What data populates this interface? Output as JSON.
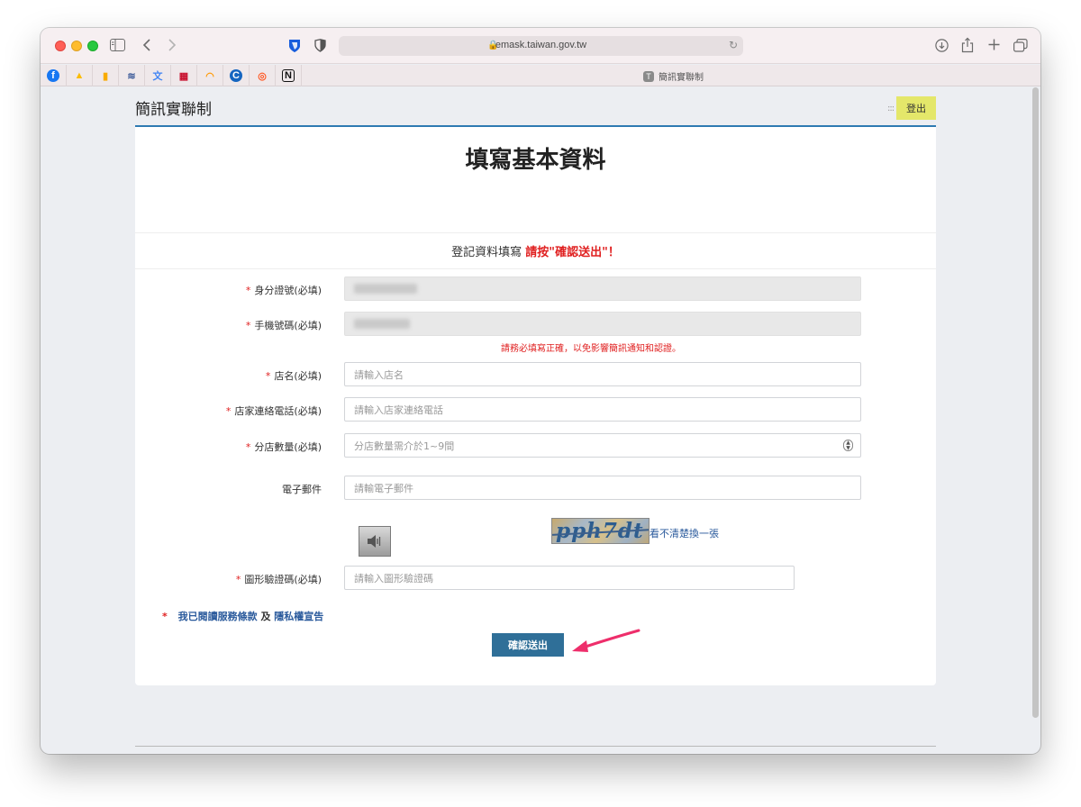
{
  "browser": {
    "url": "emask.taiwan.gov.tw",
    "tab_title": "簡訊實聯制",
    "tab_icon_letter": "T",
    "favorites": [
      {
        "icon": "facebook-icon",
        "glyph": "f",
        "color": "#1877f2"
      },
      {
        "icon": "google-ads-icon",
        "glyph": "▲",
        "color": "#fbbc04"
      },
      {
        "icon": "analytics-icon",
        "glyph": "▮",
        "color": "#f9ab00"
      },
      {
        "icon": "wifi-icon",
        "glyph": "≋",
        "color": "#3b5998"
      },
      {
        "icon": "translate-icon",
        "glyph": "文",
        "color": "#4285f4"
      },
      {
        "icon": "flag-icon",
        "glyph": "▦",
        "color": "#c8102e"
      },
      {
        "icon": "rainbow-icon",
        "glyph": "◠",
        "color": "#ff9800"
      },
      {
        "icon": "c-icon",
        "glyph": "C",
        "color": "#1565c0"
      },
      {
        "icon": "gauge-icon",
        "glyph": "◎",
        "color": "#ff5722"
      },
      {
        "icon": "notion-icon",
        "glyph": "N",
        "color": "#111111"
      }
    ]
  },
  "header": {
    "title": "簡訊實聯制",
    "logout_label": "登出",
    "logout_color": "#e4e76a"
  },
  "form": {
    "title": "填寫基本資料",
    "notice_prefix": "登記資料填寫",
    "notice_highlight": "請按\"確認送出\"！",
    "fields": {
      "id": {
        "label": "身分證號(必填)"
      },
      "phone": {
        "label": "手機號碼(必填)"
      },
      "store_name": {
        "label": "店名(必填)",
        "placeholder": "請輸入店名"
      },
      "store_phone": {
        "label": "店家連絡電話(必填)",
        "placeholder": "請輸入店家連絡電話"
      },
      "branch_count": {
        "label": "分店數量(必填)",
        "placeholder": "分店數量需介於1~9間"
      },
      "email": {
        "label": "電子郵件",
        "placeholder": "請輸電子郵件"
      },
      "captcha": {
        "label": "圖形驗證碼(必填)",
        "placeholder": "請輸入圖形驗證碼"
      }
    },
    "phone_warning": "請務必填寫正確，以免影響簡訊通知和認證。",
    "captcha_text": "pph7dt",
    "captcha_refresh": "看不清楚換一張",
    "terms": {
      "link1": "我已閱讀服務條款",
      "and": "及",
      "link2": "隱私權宣告"
    },
    "submit_label": "確認送出",
    "accent_color": "#2f6f98",
    "required_color": "#e02020"
  }
}
